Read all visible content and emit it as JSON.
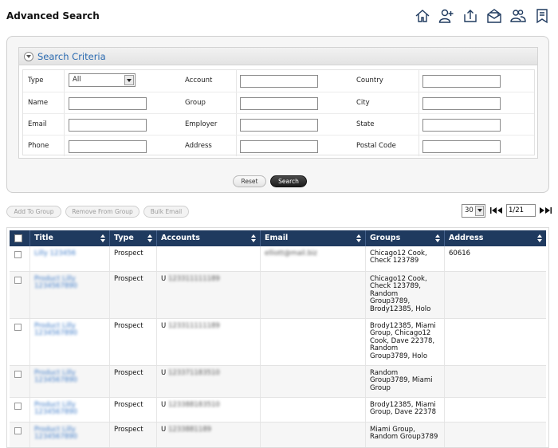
{
  "page": {
    "title": "Advanced Search"
  },
  "toolbar_icons": [
    "home-icon",
    "add-user-icon",
    "upload-icon",
    "open-mail-icon",
    "users-icon",
    "bookmark-icon"
  ],
  "criteria": {
    "title": "Search Criteria",
    "type_label": "Type",
    "type_value": "All",
    "name_label": "Name",
    "email_label": "Email",
    "phone_label": "Phone",
    "account_label": "Account",
    "group_label": "Group",
    "employer_label": "Employer",
    "address_label": "Address",
    "country_label": "Country",
    "city_label": "City",
    "state_label": "State",
    "postal_code_label": "Postal Code",
    "reset_label": "Reset",
    "search_label": "Search"
  },
  "actions": {
    "add_to_group": "Add To Group",
    "remove_from_group": "Remove From Group",
    "bulk_email": "Bulk Email"
  },
  "pager": {
    "page_size": "30",
    "page": "1/21"
  },
  "table": {
    "columns": [
      "Title",
      "Type",
      "Accounts",
      "Email",
      "Groups",
      "Address"
    ],
    "rows": [
      {
        "title": "Lilly 123456",
        "type": "Prospect",
        "account": "",
        "email": "elliott@mail.biz",
        "groups": "Chicago12 Cook, Check 123789",
        "address": "60616"
      },
      {
        "title": "Product Lilly 1234567890",
        "type": "Prospect",
        "account": "U",
        "account_blur": "123311111189",
        "email": "",
        "groups": "Chicago12 Cook, Check 123789, Random Group3789, Brody12385, Holo",
        "address": ""
      },
      {
        "title": "Product Lilly 1234567890",
        "type": "Prospect",
        "account": "U",
        "account_blur": "123311111189",
        "email": "",
        "groups": "Brody12385, Miami Group, Chicago12 Cook, Dave 22378, Random Group3789, Holo",
        "address": ""
      },
      {
        "title": "Product Lilly 1234567890",
        "type": "Prospect",
        "account": "U",
        "account_blur": "123371183510",
        "email": "",
        "groups": "Random Group3789, Miami Group",
        "address": ""
      },
      {
        "title": "Product Lilly 1234567890",
        "type": "Prospect",
        "account": "U",
        "account_blur": "123388183510",
        "email": "",
        "groups": "Brody12385, Miami Group, Dave 22378",
        "address": ""
      },
      {
        "title": "Product Lilly 1234567890",
        "type": "Prospect",
        "account": "U",
        "account_blur": "1233881189",
        "email": "",
        "groups": "Miami Group, Random Group3789",
        "address": ""
      }
    ]
  }
}
